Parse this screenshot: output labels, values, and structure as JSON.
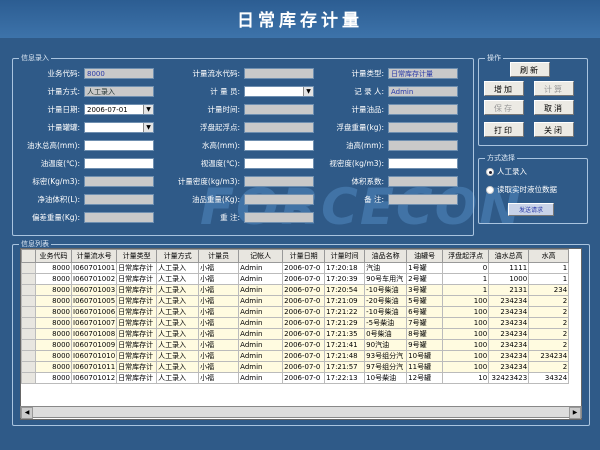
{
  "window": {
    "title": "日常库存计量"
  },
  "watermark": "力控 FORCECON",
  "info_group": {
    "title": "信息录入",
    "fields": {
      "biz_code": {
        "label": "业务代码:",
        "value": "8000"
      },
      "flow_no": {
        "label": "计量流水代码:",
        "value": ""
      },
      "meas_type": {
        "label": "计量类型:",
        "value": "日常库存计量"
      },
      "meas_method": {
        "label": "计量方式:",
        "value": "人工录入"
      },
      "meas_person": {
        "label": "计 量 员:",
        "value": ""
      },
      "recorder": {
        "label": "记 录 人:",
        "value": "Admin"
      },
      "meas_date": {
        "label": "计量日期:",
        "value": "2006-07-01"
      },
      "meas_time": {
        "label": "计量时间:",
        "value": ""
      },
      "oil_name": {
        "label": "计量油品:",
        "value": ""
      },
      "tank": {
        "label": "计量罐罐:",
        "value": ""
      },
      "float_start": {
        "label": "浮盘起浮点:",
        "value": ""
      },
      "float_weight": {
        "label": "浮盘重量(kg):",
        "value": ""
      },
      "oil_total_height": {
        "label": "油水总高(mm):",
        "value": ""
      },
      "water_height": {
        "label": "水高(mm):",
        "value": ""
      },
      "oil_height": {
        "label": "油高(mm):",
        "value": ""
      },
      "oil_temp": {
        "label": "油温度(℃):",
        "value": ""
      },
      "visual_temp": {
        "label": "视温度(℃):",
        "value": ""
      },
      "visual_density": {
        "label": "视密度(kg/m3):",
        "value": ""
      },
      "std_density": {
        "label": "标密(Kg/m3):",
        "value": ""
      },
      "meas_density": {
        "label": "计量密度(kg/m3):",
        "value": ""
      },
      "volume_coef": {
        "label": "体积系数:",
        "value": ""
      },
      "net_volume": {
        "label": "净油体积(L):",
        "value": ""
      },
      "oil_weight": {
        "label": "油品重量(Kg):",
        "value": ""
      },
      "remark2": {
        "label": "重 注:",
        "value": ""
      },
      "oil_bias": {
        "label": "偏差重量(Kg):",
        "value": ""
      },
      "remark": {
        "label": "备 注:",
        "value": ""
      }
    }
  },
  "ops_group": {
    "title": "操作",
    "buttons": {
      "refresh": "刷新",
      "add": "增加",
      "calc": "计算",
      "save": "保存",
      "cancel": "取消",
      "print": "打印",
      "close": "关闭"
    }
  },
  "mode_group": {
    "title": "方式选择",
    "manual": "人工录入",
    "realtime": "读取实时液位数据",
    "send_request": "发送请求"
  },
  "list_group": {
    "title": "信息列表",
    "columns": [
      "业务代码",
      "计量流水号",
      "计量类型",
      "计量方式",
      "计量员",
      "记帐人",
      "计量日期",
      "计量时间",
      "油品名称",
      "油罐号",
      "浮盘起浮点",
      "油水总高",
      "水高"
    ],
    "rows": [
      [
        "8000",
        "I060701001",
        "日常库存计",
        "人工录入",
        "小福",
        "Admin",
        "2006-07-0",
        "17:20:18",
        "汽油",
        "1号罐",
        "0",
        "1111",
        "1"
      ],
      [
        "8000",
        "I060701002",
        "日常库存计",
        "人工录入",
        "小福",
        "Admin",
        "2006-07-0",
        "17:20:39",
        "90号车用汽",
        "2号罐",
        "1",
        "1000",
        "1"
      ],
      [
        "8000",
        "I060701003",
        "日常库存计",
        "人工录入",
        "小福",
        "Admin",
        "2006-07-0",
        "17:20:54",
        "-10号柴油",
        "3号罐",
        "1",
        "2131",
        "234"
      ],
      [
        "8000",
        "I060701005",
        "日常库存计",
        "人工录入",
        "小福",
        "Admin",
        "2006-07-0",
        "17:21:09",
        "-20号柴油",
        "5号罐",
        "100",
        "234234",
        "2"
      ],
      [
        "8000",
        "I060701006",
        "日常库存计",
        "人工录入",
        "小福",
        "Admin",
        "2006-07-0",
        "17:21:22",
        "-10号柴油",
        "6号罐",
        "100",
        "234234",
        "2"
      ],
      [
        "8000",
        "I060701007",
        "日常库存计",
        "人工录入",
        "小福",
        "Admin",
        "2006-07-0",
        "17:21:29",
        "-5号柴油",
        "7号罐",
        "100",
        "234234",
        "2"
      ],
      [
        "8000",
        "I060701008",
        "日常库存计",
        "人工录入",
        "小福",
        "Admin",
        "2006-07-0",
        "17:21:35",
        "0号柴油",
        "8号罐",
        "100",
        "234234",
        "2"
      ],
      [
        "8000",
        "I060701009",
        "日常库存计",
        "人工录入",
        "小福",
        "Admin",
        "2006-07-0",
        "17:21:41",
        "90汽油",
        "9号罐",
        "100",
        "234234",
        "2"
      ],
      [
        "8000",
        "I060701010",
        "日常库存计",
        "人工录入",
        "小福",
        "Admin",
        "2006-07-0",
        "17:21:48",
        "93号组分汽",
        "10号罐",
        "100",
        "234234",
        "234234"
      ],
      [
        "8000",
        "I060701011",
        "日常库存计",
        "人工录入",
        "小福",
        "Admin",
        "2006-07-0",
        "17:21:57",
        "97号组分汽",
        "11号罐",
        "100",
        "234234",
        "2"
      ],
      [
        "8000",
        "I060701012",
        "日常库存计",
        "人工录入",
        "小福",
        "Admin",
        "2006-07-0",
        "17:22:13",
        "10号柴油",
        "12号罐",
        "10",
        "32423423",
        "34324"
      ]
    ]
  }
}
